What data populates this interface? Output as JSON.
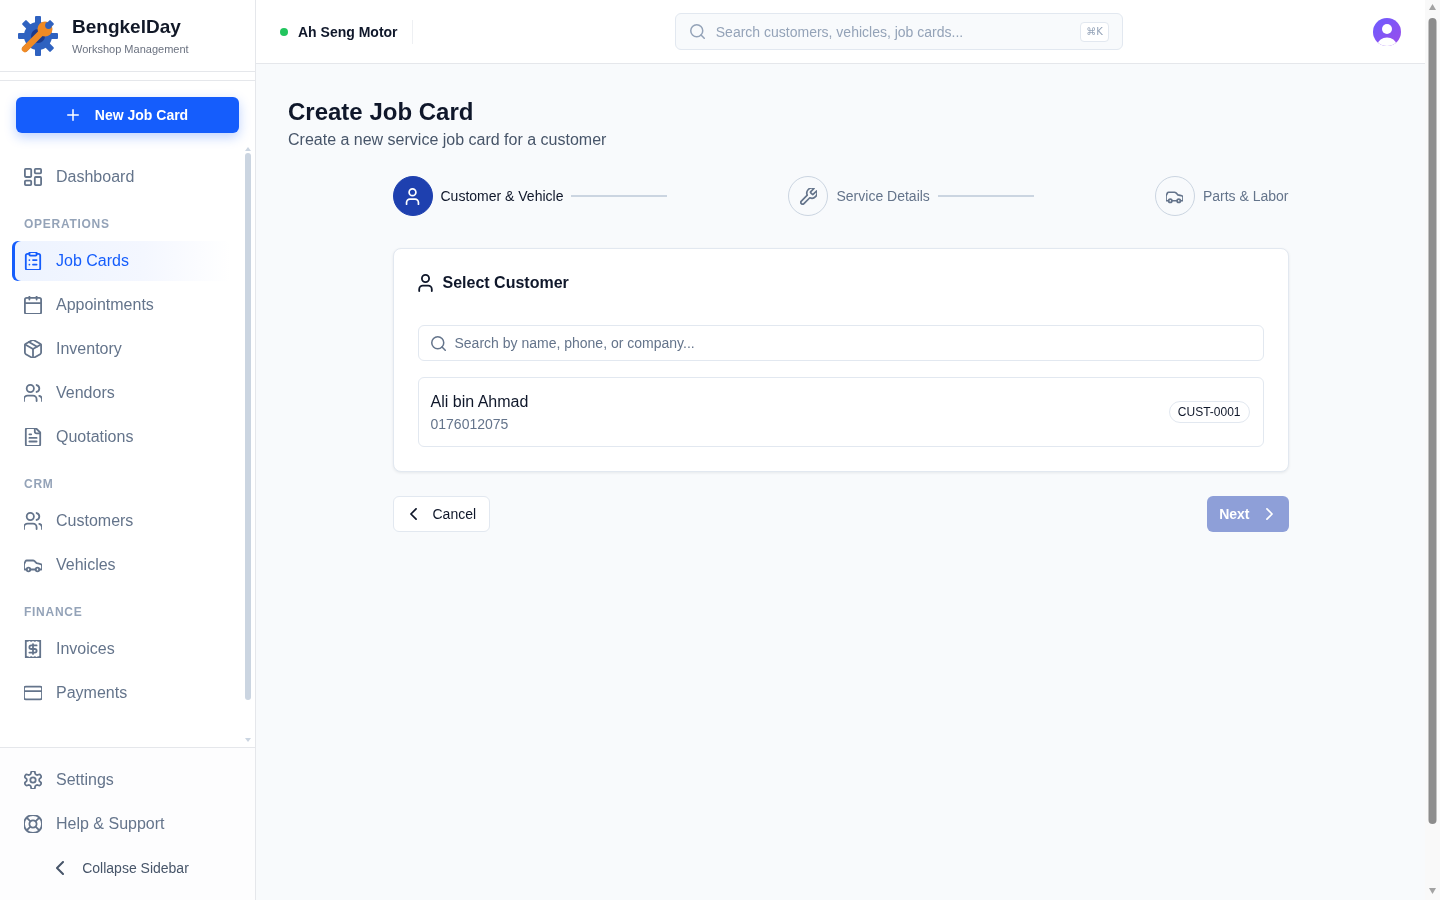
{
  "brand": {
    "name": "BengkelDay",
    "tagline": "Workshop Management"
  },
  "sidebar": {
    "new_button": "New Job Card",
    "primary_items": [
      {
        "label": "Dashboard",
        "selected": false
      }
    ],
    "groups": [
      {
        "title": "OPERATIONS",
        "items": [
          {
            "label": "Job Cards",
            "selected": true
          },
          {
            "label": "Appointments",
            "selected": false
          },
          {
            "label": "Inventory",
            "selected": false
          },
          {
            "label": "Vendors",
            "selected": false
          },
          {
            "label": "Quotations",
            "selected": false
          }
        ]
      },
      {
        "title": "CRM",
        "items": [
          {
            "label": "Customers",
            "selected": false
          },
          {
            "label": "Vehicles",
            "selected": false
          }
        ]
      },
      {
        "title": "FINANCE",
        "items": [
          {
            "label": "Invoices",
            "selected": false
          },
          {
            "label": "Payments",
            "selected": false
          }
        ]
      }
    ],
    "footer_items": [
      {
        "label": "Settings",
        "selected": false
      },
      {
        "label": "Help & Support",
        "selected": false
      }
    ],
    "collapse_button": "Collapse Sidebar"
  },
  "topbar": {
    "workshop": {
      "name": "Ah Seng Motor",
      "online": true
    },
    "search": {
      "placeholder": "Search customers, vehicles, job cards...",
      "shortcut": "⌘K"
    }
  },
  "page": {
    "title": "Create Job Card",
    "subtitle": "Create a new service job card for a customer"
  },
  "stepper": {
    "steps": [
      {
        "label": "Customer & Vehicle",
        "current": true
      },
      {
        "label": "Service Details",
        "current": false
      },
      {
        "label": "Parts & Labor",
        "current": false
      }
    ]
  },
  "customer_panel": {
    "title": "Select Customer",
    "search": {
      "placeholder": "Search by name, phone, or company..."
    },
    "customers": [
      {
        "name": "Ali bin Ahmad",
        "phone": "0176012075",
        "code": "CUST-0001",
        "selected": false
      }
    ]
  },
  "actions": {
    "cancel": "Cancel",
    "next": {
      "label": "Next",
      "disabled": true
    }
  }
}
